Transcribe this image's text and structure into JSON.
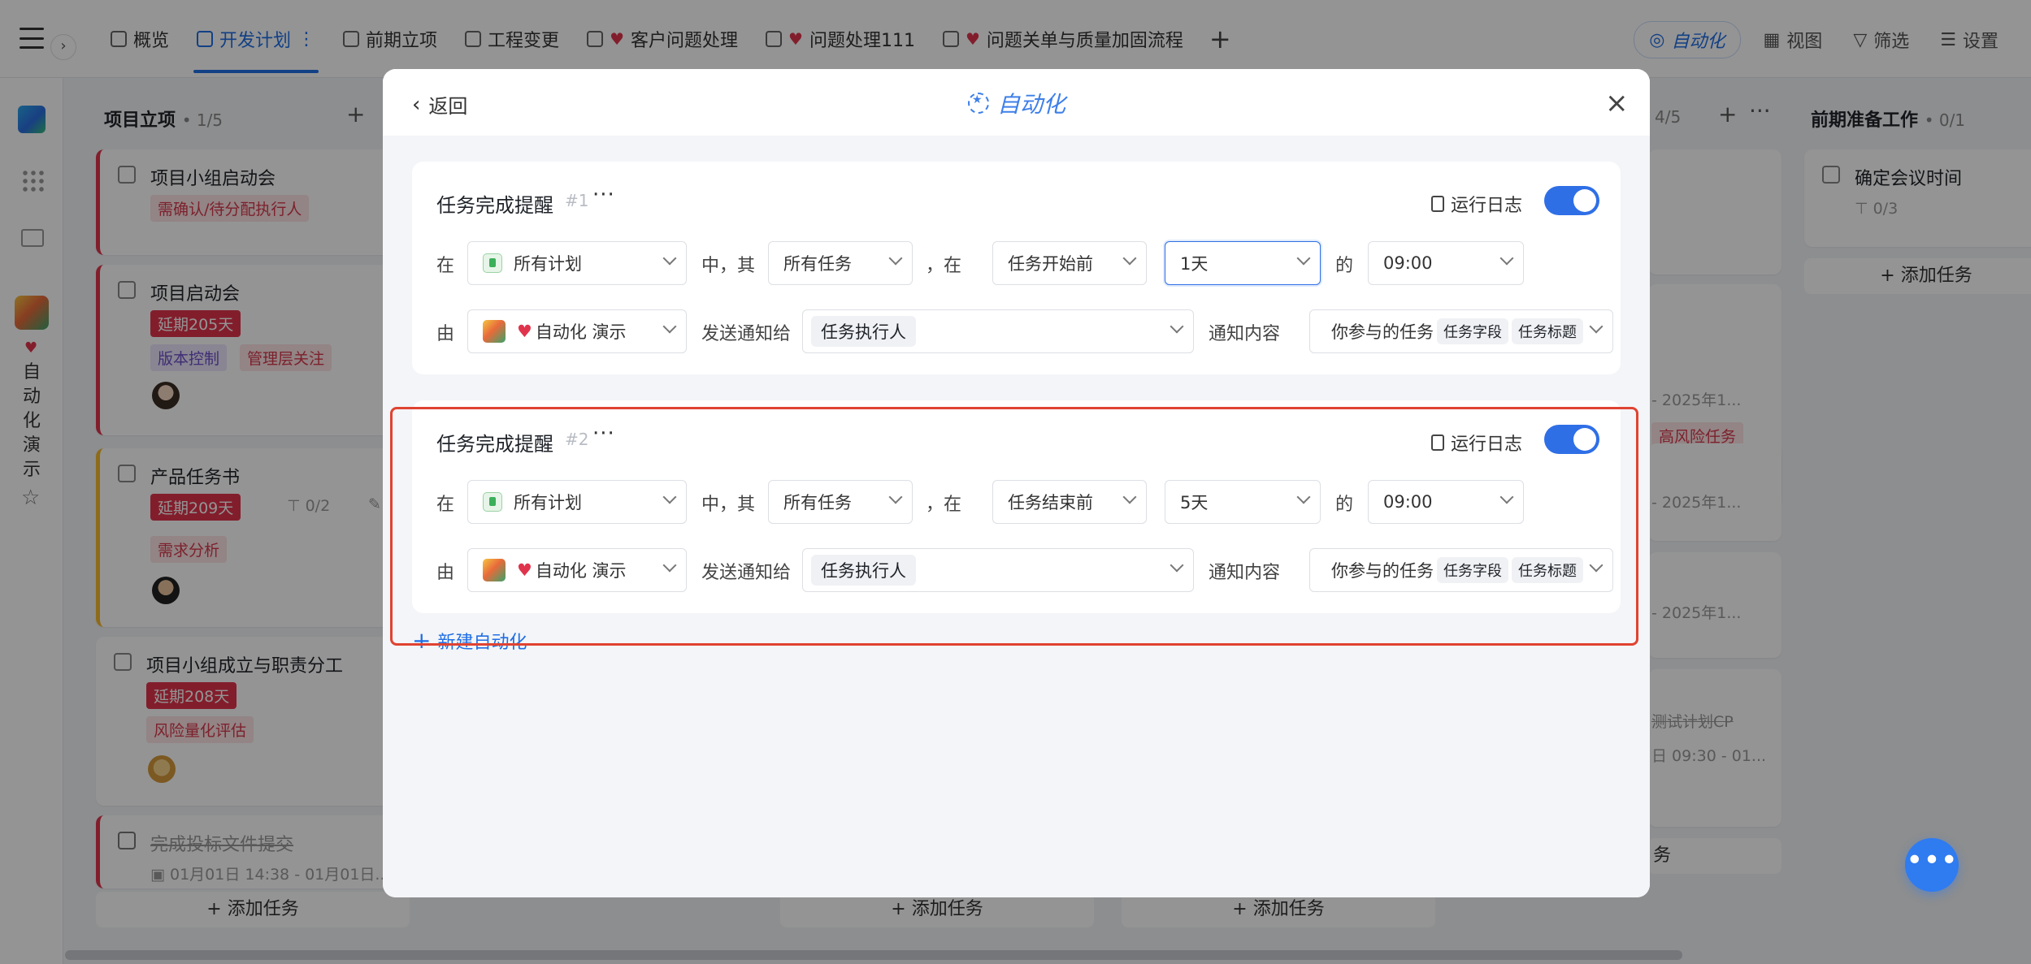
{
  "topbar": {
    "tabs": [
      {
        "label": "概览",
        "icon": "dashboard-icon"
      },
      {
        "label": "开发计划",
        "icon": "table-icon",
        "active": true
      },
      {
        "label": "前期立项",
        "icon": "table-icon"
      },
      {
        "label": "工程变更",
        "icon": "gantt-icon"
      },
      {
        "label": "客户问题处理",
        "icon": "gantt-icon",
        "heart": true
      },
      {
        "label": "问题处理111",
        "icon": "doc-icon",
        "heart": true
      },
      {
        "label": "问题关单与质量加固流程",
        "icon": "gantt-icon",
        "heart": true
      }
    ],
    "tab_more": "⋮",
    "add_tab": "+",
    "automation": "自动化",
    "view": "视图",
    "filter": "筛选",
    "settings": "设置"
  },
  "leftbar": {
    "app_heart": "♥",
    "app_name_vertical": [
      "自",
      "动",
      "化",
      "演",
      "示"
    ],
    "star": "☆"
  },
  "board": {
    "col1": {
      "title": "项目立项",
      "count": "• 1/5",
      "cards": [
        {
          "title": "项目小组启动会",
          "tags": [
            "需确认/待分配执行人"
          ]
        },
        {
          "title": "项目启动会",
          "overdue": "延期205天",
          "tags": [
            "版本控制",
            "管理层关注"
          ]
        },
        {
          "title": "产品任务书",
          "overdue": "延期209天",
          "sub": "0/2",
          "tags": [
            "需求分析"
          ]
        },
        {
          "title": "项目小组成立与职责分工",
          "overdue": "延期208天",
          "tags": [
            "风险量化评估"
          ]
        },
        {
          "title": "完成投标文件提交",
          "date": "01月01日 14:38 - 01月01日..."
        }
      ],
      "add": "+ 添加任务"
    },
    "col3_add": "+ 添加任务",
    "col4_add": "+ 添加任务",
    "col5": {
      "count": "4/5",
      "partial": [
        "- 2025年1...",
        "高风险任务",
        "- 2025年1...",
        "- 2025年1...",
        "测试计划CP",
        "日 09:30 - 01...",
        "务"
      ]
    },
    "col6": {
      "title": "前期准备工作",
      "count": "• 0/1",
      "cards": [
        {
          "title": "确定会议时间",
          "sub": "0/3"
        }
      ],
      "add": "+ 添加任务"
    }
  },
  "modal": {
    "back": "返回",
    "title": "自动化",
    "close": "×",
    "rules": [
      {
        "name": "任务完成提醒",
        "num": "#1",
        "more": "···",
        "log": "运行日志",
        "enabled": true,
        "row1": {
          "at": "在",
          "plan": "所有计划",
          "mid": "中，其",
          "scope": "所有任务",
          "comma_at": "，在",
          "trigger": "任务开始前",
          "offset": "1天",
          "of": "的",
          "time": "09:00"
        },
        "row2": {
          "by": "由",
          "sender": "自动化 演示",
          "send_to": "发送通知给",
          "recipient": "任务执行人",
          "content_label": "通知内容",
          "content_text": "你参与的任务",
          "chips": [
            "任务字段",
            "任务标题"
          ]
        }
      },
      {
        "name": "任务完成提醒",
        "num": "#2",
        "more": "···",
        "log": "运行日志",
        "enabled": true,
        "row1": {
          "at": "在",
          "plan": "所有计划",
          "mid": "中，其",
          "scope": "所有任务",
          "comma_at": "，在",
          "trigger": "任务结束前",
          "offset": "5天",
          "of": "的",
          "time": "09:00"
        },
        "row2": {
          "by": "由",
          "sender": "自动化 演示",
          "send_to": "发送通知给",
          "recipient": "任务执行人",
          "content_label": "通知内容",
          "content_text": "你参与的任务",
          "chips": [
            "任务字段",
            "任务标题"
          ]
        }
      }
    ],
    "new_automation": "新建自动化"
  },
  "fab": "•••"
}
